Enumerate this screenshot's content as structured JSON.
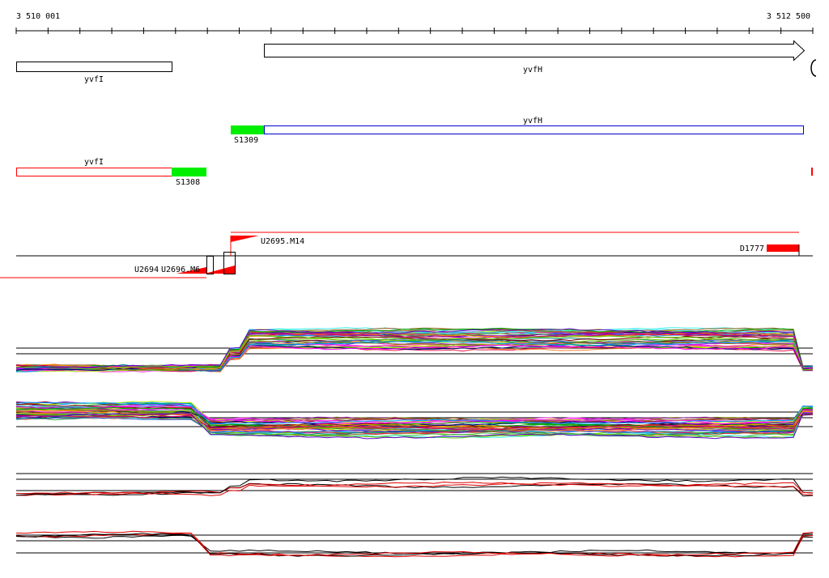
{
  "ruler": {
    "start_label": "3 510 001",
    "end_label": "3 512 500",
    "start": 3510001,
    "end": 3512500
  },
  "colors": {
    "outline_black": "#000000",
    "annotation_red": "#ff0000",
    "annotation_blue": "#0000cc",
    "shine_green": "#00ee00",
    "profile_red": "#dd0000"
  },
  "genes": {
    "yvfI_top": "yvfI",
    "yvfH_top": "yvfH",
    "yvfH_transcript": "yvfH",
    "yvfI_transcript": "yvfI"
  },
  "features": {
    "s1309": "S1309",
    "s1308": "S1308",
    "u2695": "U2695.M14",
    "u2694": "U2694",
    "u2696": "U2696.M6",
    "d1777": "D1777"
  },
  "tracks": [
    {
      "id": "forward-strand-all-conditions",
      "level": "low-to-high",
      "shift": "3 510 690"
    },
    {
      "id": "reverse-strand-all-conditions",
      "level": "high-to-low",
      "shift": "3 510 570"
    },
    {
      "id": "forward-strand-summary",
      "level": "low-to-high",
      "shift": "3 510 690"
    },
    {
      "id": "reverse-strand-summary",
      "level": "high-to-low",
      "shift": "3 510 570"
    }
  ]
}
